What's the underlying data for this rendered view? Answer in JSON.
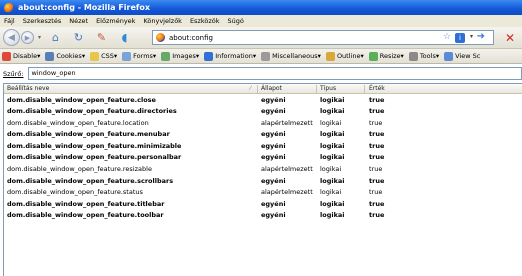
{
  "window": {
    "title": "about:config - Mozilla Firefox"
  },
  "menu": [
    "Fájl",
    "Szerkesztés",
    "Nézet",
    "Előzmények",
    "Könyvjelzők",
    "Eszközök",
    "Súgó"
  ],
  "nav": {
    "url": "about:config"
  },
  "devbar": [
    {
      "label": "Disable▾",
      "icon": "no-entry-icon",
      "color": "#e0483a"
    },
    {
      "label": "Cookies▾",
      "icon": "person-icon",
      "color": "#5a7fb8"
    },
    {
      "label": "CSS▾",
      "icon": "css-icon",
      "color": "#e8c64a"
    },
    {
      "label": "Forms▾",
      "icon": "forms-icon",
      "color": "#7aa3d8"
    },
    {
      "label": "Images▾",
      "icon": "images-icon",
      "color": "#6aa86a"
    },
    {
      "label": "Information▾",
      "icon": "info-icon",
      "color": "#2f6fd6"
    },
    {
      "label": "Miscellaneous▾",
      "icon": "misc-icon",
      "color": "#9a9a9a"
    },
    {
      "label": "Outline▾",
      "icon": "pencil-icon",
      "color": "#d8a83a"
    },
    {
      "label": "Resize▾",
      "icon": "resize-icon",
      "color": "#5ab05a"
    },
    {
      "label": "Tools▾",
      "icon": "wrench-icon",
      "color": "#8a8a8a"
    },
    {
      "label": "View Sc",
      "icon": "view-source-icon",
      "color": "#5a8ad8"
    }
  ],
  "filter": {
    "label": "Szűrő:",
    "value": "window_open"
  },
  "columns": {
    "name": "Beállítás neve",
    "status": "Állapot",
    "type": "Típus",
    "value": "Érték"
  },
  "rows": [
    {
      "name": "dom.disable_window_open_feature.close",
      "status": "egyéni",
      "type": "logikai",
      "value": "true",
      "bold": true
    },
    {
      "name": "dom.disable_window_open_feature.directories",
      "status": "egyéni",
      "type": "logikai",
      "value": "true",
      "bold": true
    },
    {
      "name": "dom.disable_window_open_feature.location",
      "status": "alapértelmezett",
      "type": "logikai",
      "value": "true",
      "bold": false
    },
    {
      "name": "dom.disable_window_open_feature.menubar",
      "status": "egyéni",
      "type": "logikai",
      "value": "true",
      "bold": true
    },
    {
      "name": "dom.disable_window_open_feature.minimizable",
      "status": "egyéni",
      "type": "logikai",
      "value": "true",
      "bold": true
    },
    {
      "name": "dom.disable_window_open_feature.personalbar",
      "status": "egyéni",
      "type": "logikai",
      "value": "true",
      "bold": true
    },
    {
      "name": "dom.disable_window_open_feature.resizable",
      "status": "alapértelmezett",
      "type": "logikai",
      "value": "true",
      "bold": false
    },
    {
      "name": "dom.disable_window_open_feature.scrollbars",
      "status": "egyéni",
      "type": "logikai",
      "value": "true",
      "bold": true
    },
    {
      "name": "dom.disable_window_open_feature.status",
      "status": "alapértelmezett",
      "type": "logikai",
      "value": "true",
      "bold": false
    },
    {
      "name": "dom.disable_window_open_feature.titlebar",
      "status": "egyéni",
      "type": "logikai",
      "value": "true",
      "bold": true
    },
    {
      "name": "dom.disable_window_open_feature.toolbar",
      "status": "egyéni",
      "type": "logikai",
      "value": "true",
      "bold": true
    }
  ]
}
